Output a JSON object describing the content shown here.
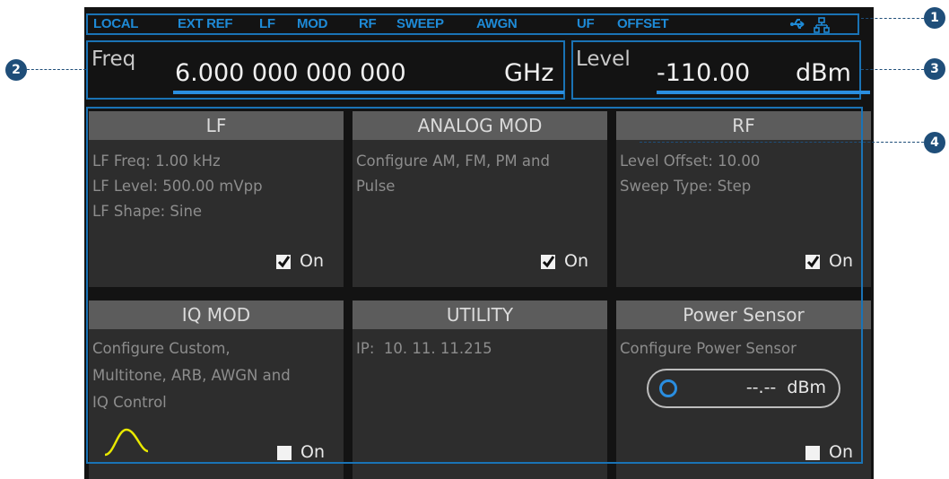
{
  "status_bar": {
    "items": [
      "LOCAL",
      "EXT REF",
      "LF",
      "MOD",
      "RF",
      "SWEEP",
      "AWGN",
      "UF",
      "OFFSET"
    ],
    "icons": [
      "usb-icon",
      "network-icon"
    ],
    "color": "#1e8ad6"
  },
  "frequency": {
    "label": "Freq",
    "value": "6.000 000 000 000",
    "unit": "GHz"
  },
  "level": {
    "label": "Level",
    "value": "-110.00",
    "unit": "dBm"
  },
  "panels": [
    {
      "title": "LF",
      "lines": [
        "LF Freq: 1.00 kHz",
        "LF Level: 500.00 mVpp",
        "LF Shape: Sine"
      ],
      "checked": true,
      "toggle_label": "On"
    },
    {
      "title": "ANALOG MOD",
      "lines": [
        "Configure AM, FM, PM and",
        "Pulse"
      ],
      "checked": true,
      "toggle_label": "On"
    },
    {
      "title": "RF",
      "lines": [
        "Level Offset: 10.00",
        "Sweep Type: Step"
      ],
      "checked": true,
      "toggle_label": "On"
    },
    {
      "title": "IQ MOD",
      "lines": [
        "Configure Custom,",
        "Multitone, ARB, AWGN and",
        "IQ Control"
      ],
      "checked": false,
      "toggle_label": "On",
      "icon": "sine-wave-icon"
    },
    {
      "title": "UTILITY",
      "lines": [
        "IP:  10. 11. 11.215"
      ]
    },
    {
      "title": "Power Sensor",
      "lines": [
        "Configure Power Sensor"
      ],
      "checked": false,
      "toggle_label": "On",
      "sensor_value": "--.--",
      "sensor_unit": "dBm"
    }
  ],
  "callouts": [
    "1",
    "2",
    "3",
    "4"
  ],
  "colors": {
    "accent": "#2a8ee0",
    "callout": "#1f4e79",
    "panel_bg": "#2d2d2d",
    "panel_header": "#5c5c5c"
  }
}
